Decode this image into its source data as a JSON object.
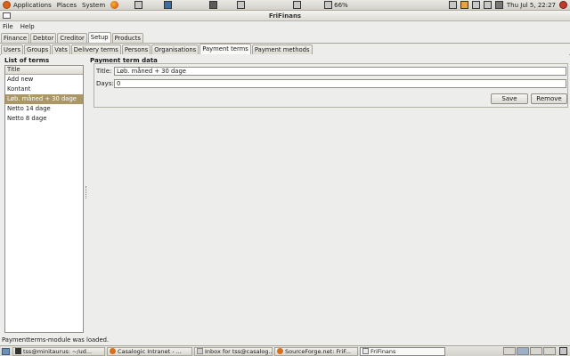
{
  "top_panel": {
    "menus": [
      "Applications",
      "Places",
      "System"
    ],
    "battery": "66%",
    "clock": "Thu Jul  5, 22:27"
  },
  "window": {
    "title": "FriFinans"
  },
  "menubar": [
    "File",
    "Help"
  ],
  "main_tabs": [
    "Finance",
    "Debtor",
    "Creditor",
    "Setup",
    "Products"
  ],
  "main_tab_active": "Setup",
  "sub_tabs": [
    "Users",
    "Groups",
    "Vats",
    "Delivery terms",
    "Persons",
    "Organisations",
    "Payment terms",
    "Payment methods"
  ],
  "sub_tab_active": "Payment terms",
  "list": {
    "frame_title": "List of terms",
    "column_header": "Title",
    "rows": [
      "Add new",
      "Kontant",
      "Løb. måned + 30 dage",
      "Netto 14 dage",
      "Netto 8 dage"
    ],
    "selected_row": "Løb. måned + 30 dage"
  },
  "form": {
    "frame_title": "Payment term data",
    "title_label": "Title:",
    "title_value": "Løb. måned + 30 dage",
    "days_label": "Days:",
    "days_value": "0",
    "save_label": "Save",
    "remove_label": "Remove"
  },
  "status": "Paymentterms-module was loaded.",
  "taskbar": [
    {
      "label": "tss@minitaurus: ~/ud...",
      "icon": "terminal-icon",
      "active": false
    },
    {
      "label": "Casalogic Intranet - ...",
      "icon": "firefox-icon",
      "active": false
    },
    {
      "label": "Inbox for tss@casalog...",
      "icon": "mail-icon",
      "active": false
    },
    {
      "label": "SourceForge.net: FriF...",
      "icon": "firefox-icon",
      "active": false
    },
    {
      "label": "FriFinans",
      "icon": "app-window-icon",
      "active": true
    }
  ],
  "colors": {
    "selection": "#ab9765",
    "ubuntu_orange": "#d86018"
  }
}
